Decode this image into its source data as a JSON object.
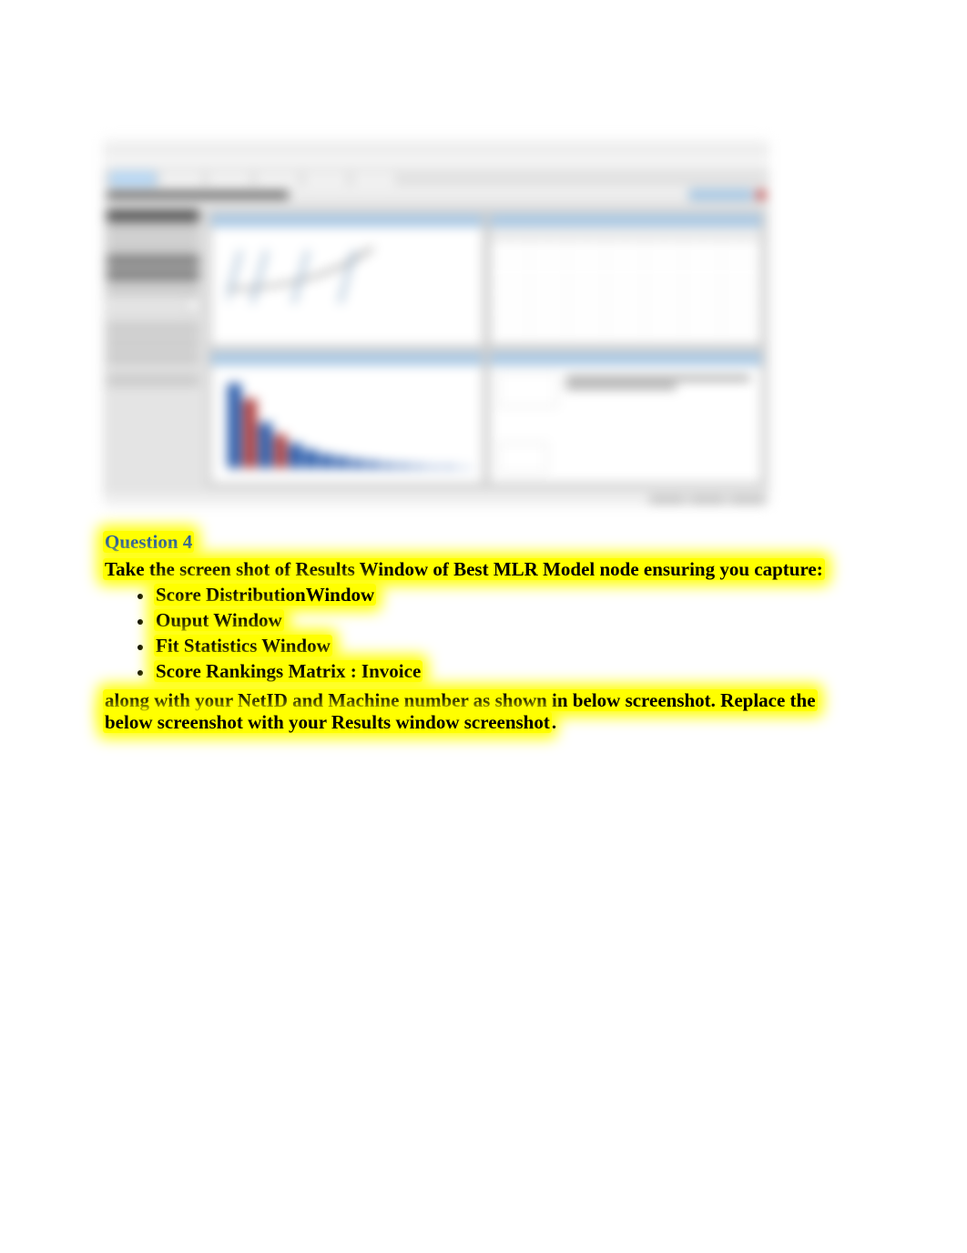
{
  "question": {
    "heading": "Question 4",
    "intro": "Take the screen shot of Results Window of Best MLR Model node ensuring you capture:",
    "bullets": [
      "Score DistributionWindow",
      "Ouput Window",
      "Fit Statistics Window",
      "Score Rankings Matrix : Invoice"
    ],
    "outro_hl": "along with your NetID and Machine number as shown in below screenshot. Replace the below screenshot with your Results window screenshot",
    "outro_tail": "."
  }
}
